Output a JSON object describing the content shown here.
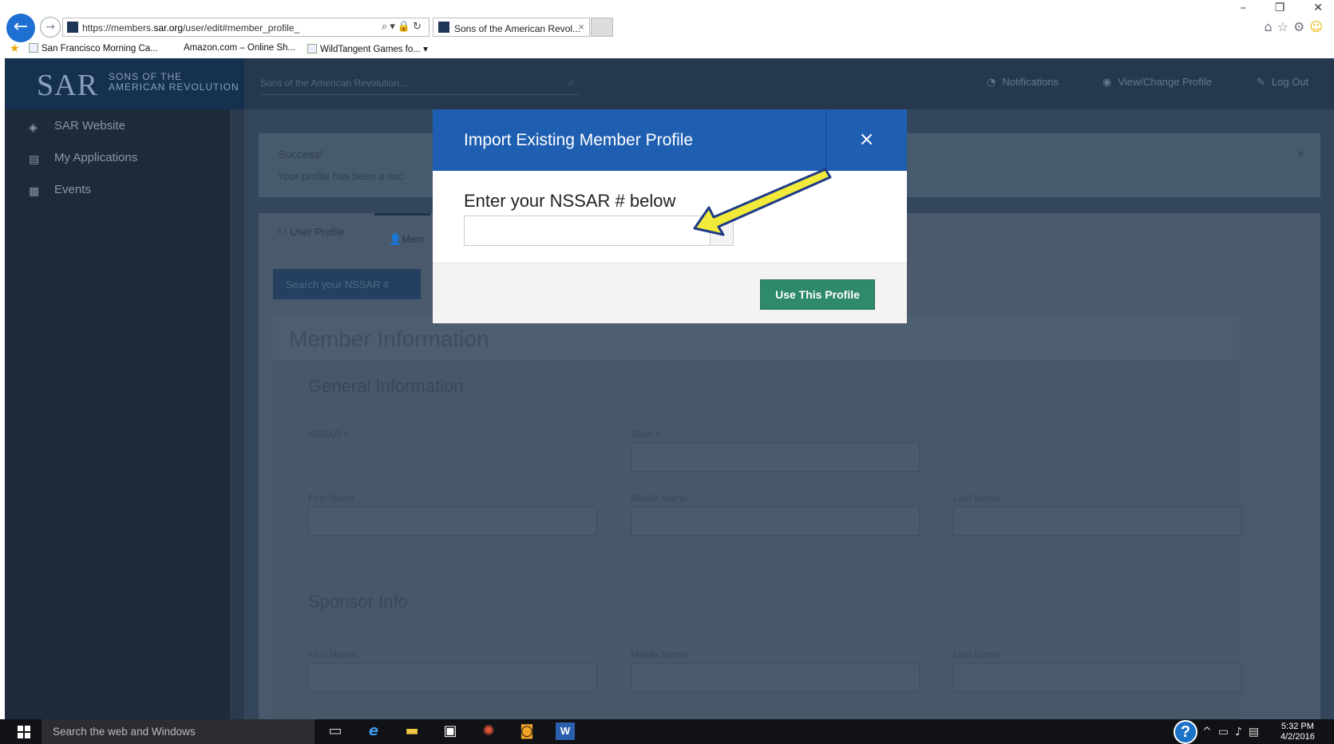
{
  "browser": {
    "url_prefix": "https://members.",
    "url_domain": "sar.org",
    "url_path": "/user/edit#member_profile_",
    "tab_title": "Sons of the American Revol...",
    "tab_close": "×",
    "favorites": [
      {
        "label": "San Francisco Morning Ca..."
      },
      {
        "label": "Amazon.com – Online Sh..."
      },
      {
        "label": "WildTangent Games fo..."
      }
    ]
  },
  "site": {
    "logo_text": "SAR",
    "logo_sub_line1": "SONS OF THE",
    "logo_sub_line2": "AMERICAN REVOLUTION",
    "search_placeholder": "Sons of the American Revolution...",
    "nav": [
      {
        "label": "SAR Website",
        "icon": "layers-icon"
      },
      {
        "label": "My Applications",
        "icon": "document-icon"
      },
      {
        "label": "Events",
        "icon": "calendar-icon"
      }
    ],
    "top_links": {
      "notifications": "Notifications",
      "profile": "View/Change Profile",
      "logout": "Log Out"
    },
    "alert": {
      "title": "Success!",
      "body": "Your profile has been a suc"
    },
    "tabs": {
      "user_profile": "User Profile",
      "member": "Mem"
    },
    "search_nssar_button": "Search your NSSAR #",
    "member_title": "Member Information",
    "general_info": "General Information",
    "sponsor_info": "Sponsor Info",
    "fields": {
      "nssar": "NSSAR #",
      "state": "State #",
      "first_name": "First Name",
      "middle_name": "Middle Name",
      "last_name": "Last Name"
    }
  },
  "modal": {
    "title": "Import Existing Member Profile",
    "close": "×",
    "label": "Enter your NSSAR # below",
    "input_value": "",
    "submit": "Use This Profile"
  },
  "taskbar": {
    "search_placeholder": "Search the web and Windows",
    "time": "5:32 PM",
    "date": "4/2/2016"
  },
  "colors": {
    "modal_header": "#1f5fb2",
    "submit_button": "#2f8a6a",
    "arrow": "#f2ea3a"
  }
}
